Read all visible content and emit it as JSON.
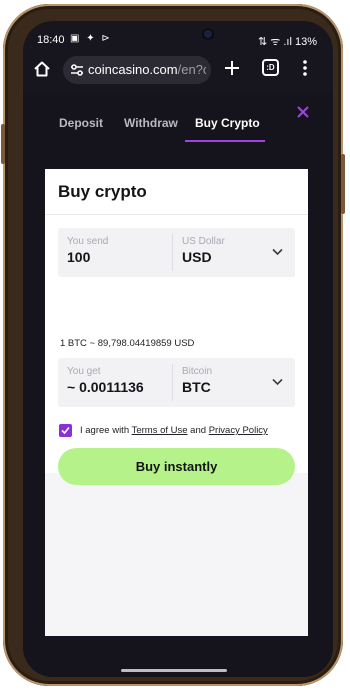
{
  "status_bar": {
    "time": "18:40",
    "left_icons": "▣ ✦ ⊳",
    "right_text": "⇅ ᯤ .ıl 13%"
  },
  "browser": {
    "url_main": "coincasino.com",
    "url_dim": "/en?c",
    "tabs_count": ":D"
  },
  "tabs": {
    "deposit": "Deposit",
    "withdraw": "Withdraw",
    "buy_crypto": "Buy Crypto"
  },
  "card": {
    "title": "Buy crypto",
    "send": {
      "label": "You send",
      "amount": "100",
      "currency_label": "US Dollar",
      "currency": "USD"
    },
    "rate": "1 BTC ~ 89,798.04419859 USD",
    "get": {
      "label": "You get",
      "amount": "~ 0.0011136",
      "currency_label": "Bitcoin",
      "currency": "BTC"
    },
    "agree": {
      "prefix": "I agree with ",
      "terms": "Terms of Use",
      "middle": " and ",
      "privacy": "Privacy Policy"
    },
    "buy_button": "Buy instantly"
  },
  "colors": {
    "accent_purple": "#8b2fd6",
    "button_green": "#b6f28a",
    "background_dark": "#15141c"
  }
}
